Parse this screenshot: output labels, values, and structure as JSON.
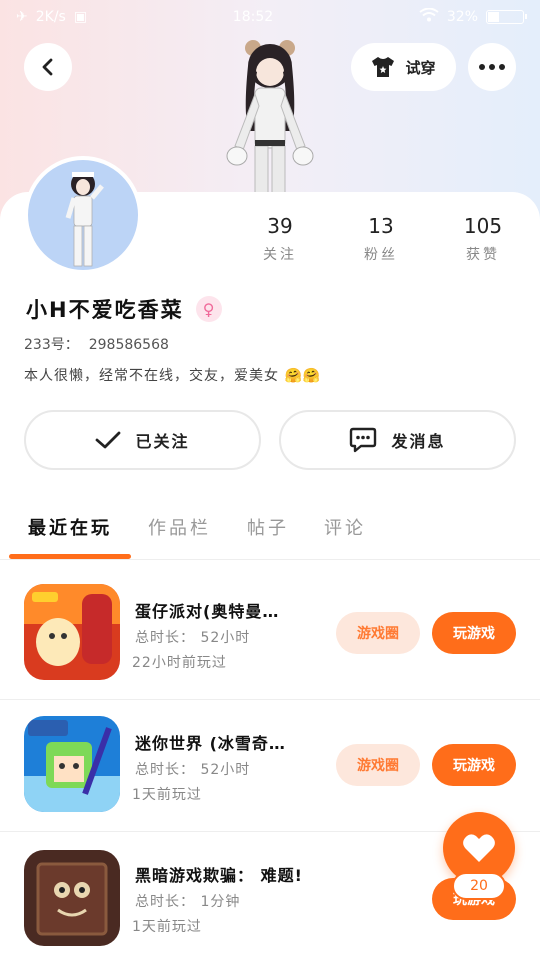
{
  "status_bar": {
    "network": "2K/s",
    "time": "18:52",
    "battery": "32%",
    "battery_level": 0.32
  },
  "header": {
    "try_on_label": "试穿"
  },
  "profile": {
    "stats": [
      {
        "value": "39",
        "label": "关注"
      },
      {
        "value": "13",
        "label": "粉丝"
      },
      {
        "value": "105",
        "label": "获赞"
      }
    ],
    "username": "小H不爱吃香菜",
    "gender": "female",
    "uid_label": "233号：",
    "uid_value": "298586568",
    "bio": "本人很懒，经常不在线，交友，爱美女"
  },
  "actions": {
    "follow_label": "已关注",
    "message_label": "发消息"
  },
  "tabs": [
    "最近在玩",
    "作品栏",
    "帖子",
    "评论"
  ],
  "games": [
    {
      "title": "蛋仔派对(奥特曼…",
      "duration": "总时长： 52小时",
      "last_played": "22小时前玩过",
      "circle_label": "游戏圈",
      "play_label": "玩游戏"
    },
    {
      "title": "迷你世界 (冰雪奇…",
      "duration": "总时长： 52小时",
      "last_played": "1天前玩过",
      "circle_label": "游戏圈",
      "play_label": "玩游戏"
    },
    {
      "title": "黑暗游戏欺骗： 难题!",
      "duration": "总时长： 1分钟",
      "last_played": "1天前玩过",
      "play_label": "玩游戏"
    }
  ],
  "fab": {
    "like_count": "20"
  },
  "colors": {
    "accent": "#ff6d1a",
    "accent_soft": "#fde7dc"
  }
}
